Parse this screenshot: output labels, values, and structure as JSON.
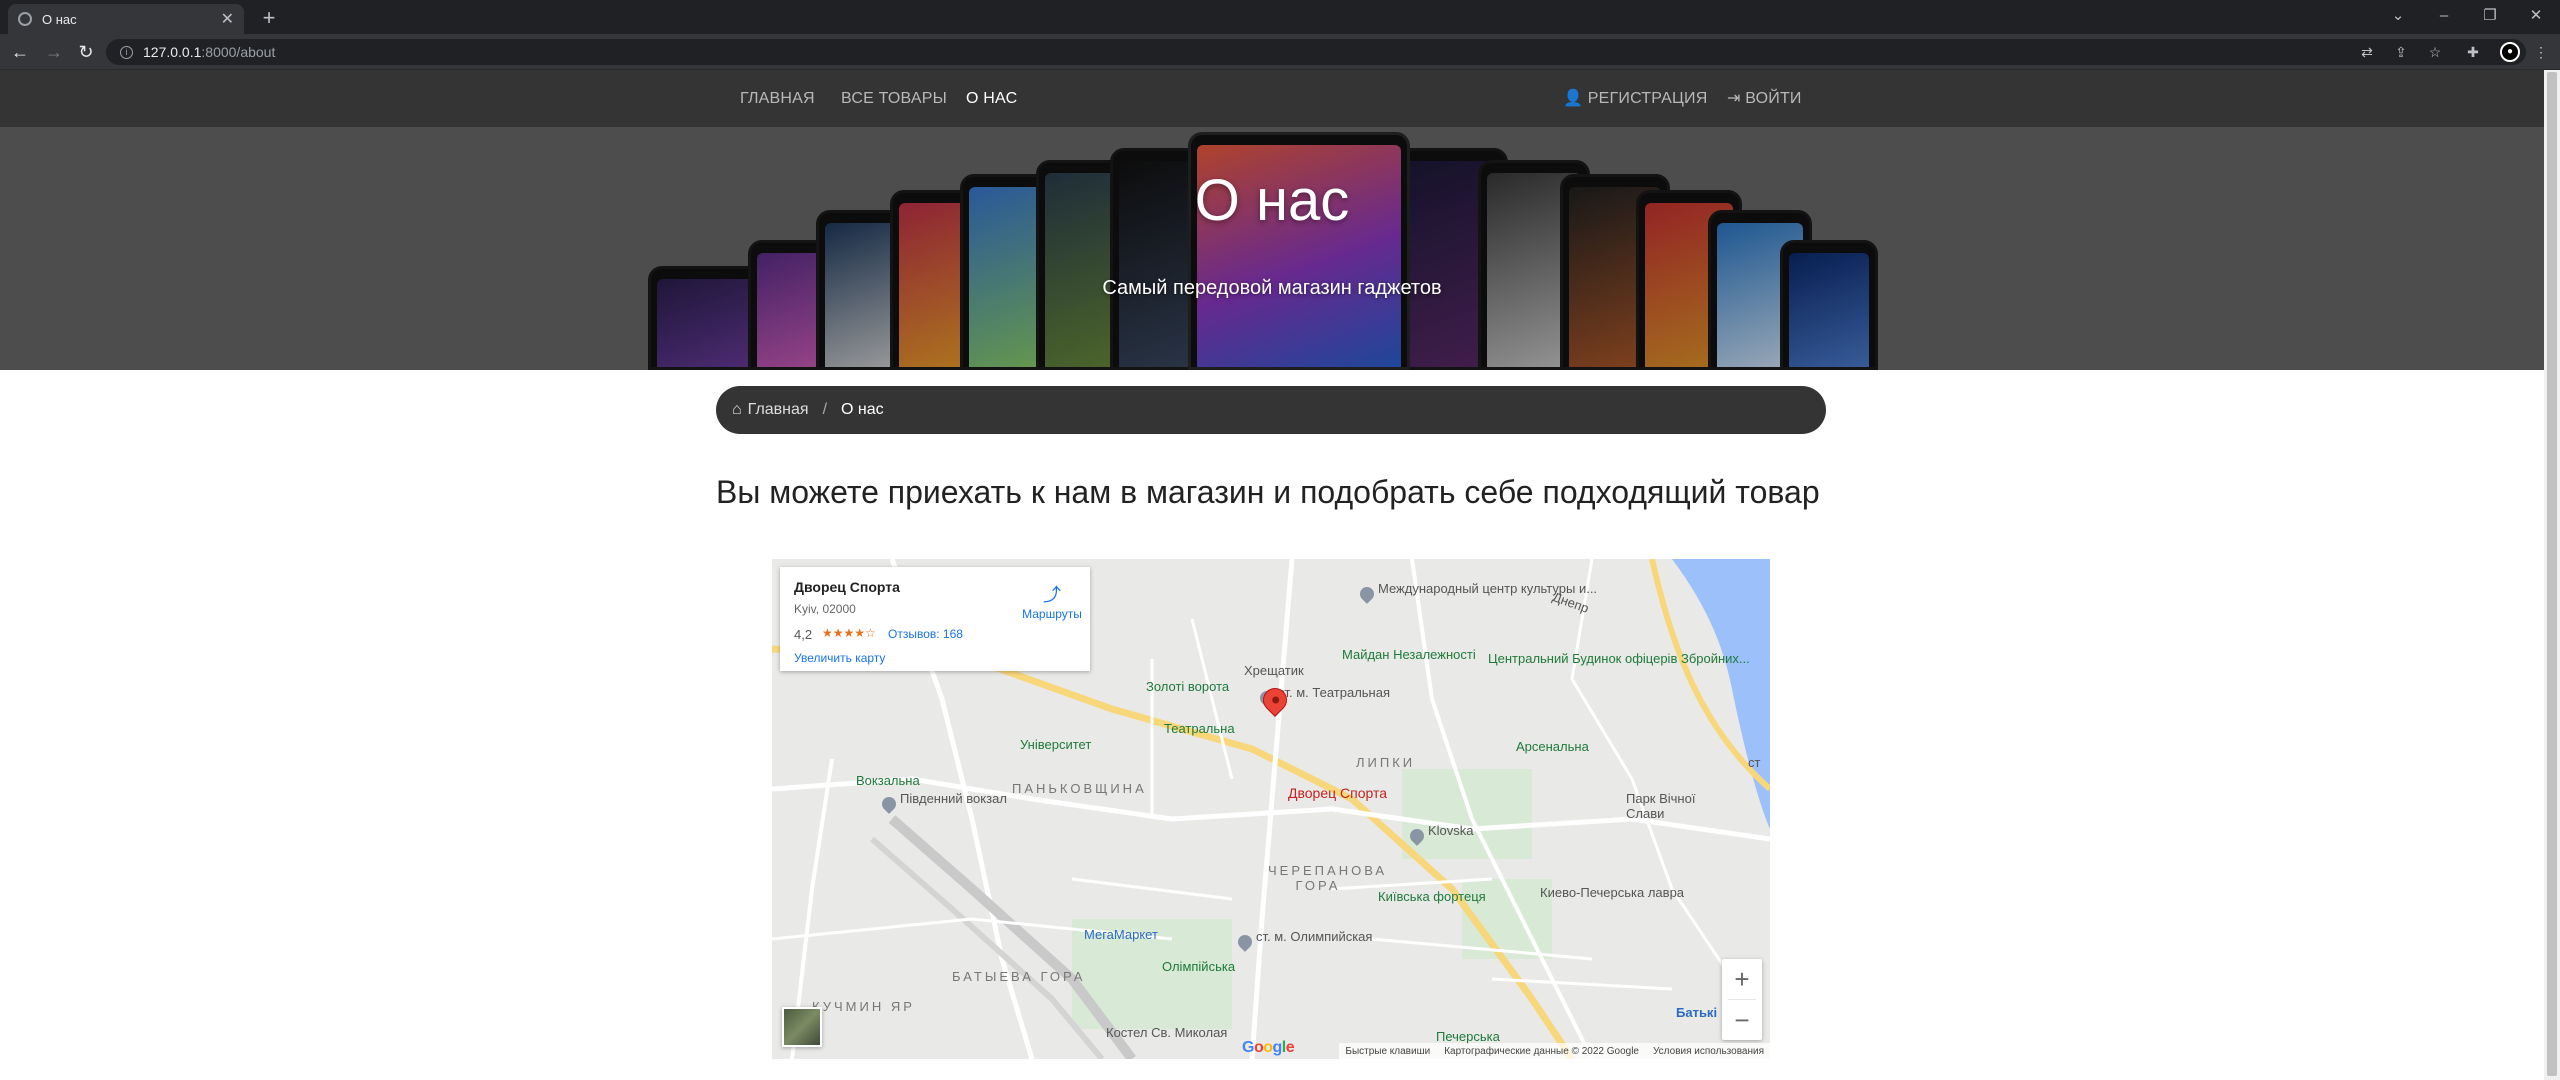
{
  "browser": {
    "tab_title": "О нас",
    "url_host": "127.0.0.1",
    "url_path": ":8000/about",
    "new_tab": "+",
    "icons": [
      "back-icon",
      "forward-icon",
      "reload-icon",
      "translate-icon",
      "share-icon",
      "bookmark-star-icon",
      "extensions-icon",
      "profile-icon",
      "menu-icon"
    ]
  },
  "nav": {
    "home": "ГЛАВНАЯ",
    "all_products": "ВСЕ ТОВАРЫ",
    "about": "О НАС",
    "register": "РЕГИСТРАЦИЯ",
    "login": "ВОЙТИ"
  },
  "hero": {
    "title": "О нас",
    "subtitle": "Самый передовой магазин гаджетов"
  },
  "breadcrumb": {
    "home": "Главная",
    "current": "О нас"
  },
  "main": {
    "heading": "Вы можете приехать к нам в магазин и подобрать себе подходящий товар"
  },
  "map": {
    "place_card": {
      "name": "Дворец Спорта",
      "address": "Kyiv, 02000",
      "rating": "4,2",
      "stars": "★★★★☆",
      "reviews": "Отзывов: 168",
      "enlarge": "Увеличить карту",
      "directions": "Маршруты"
    },
    "marker_label": "Дворец Спорта",
    "labels": {
      "international_center": "Международный центр культуры и...",
      "khreshchatyk": "Хрещатик",
      "maidan": "Майдан Незалежності",
      "zoloti_vorota": "Золоті ворота",
      "teatralna_station": "ст. м. Театральная",
      "teatralna": "Театральна",
      "central_house": "Центральний Будинок офіцерів Збройних...",
      "universytet": "Університет",
      "lypky": "ЛИПКИ",
      "arsenalna": "Арсенальна",
      "vokzalna": "Вокзальна",
      "pivdennyi": "Південний вокзал",
      "pankivshchyna": "ПАНЬКОВЩИНА",
      "klovska": "Klovska",
      "park": "Парк Вічної Слави",
      "cherepanova": "ЧЕРЕПАНОВА ГОРА",
      "kyiv_fortress": "Київська фортеця",
      "lavra": "Киево-Печерська лавра",
      "megamarket": "МегаМаркет",
      "olimpiyska_station": "ст. м. Олимпийская",
      "olimpiyska": "Олімпійська",
      "batyieva": "БАТЫЕВА ГОРА",
      "kuchmin": "КУЧМИН ЯР",
      "kostel": "Костел Св. Миколая",
      "pechersk": "Печерська",
      "dnipro": "Днепр",
      "batkivshchyna": "Батькі",
      "st": "ст"
    },
    "zoom_in": "+",
    "zoom_out": "−",
    "footer": {
      "shortcuts": "Быстрые клавиши",
      "data": "Картографические данные © 2022 Google",
      "terms": "Условия использования"
    },
    "google": "Google"
  }
}
